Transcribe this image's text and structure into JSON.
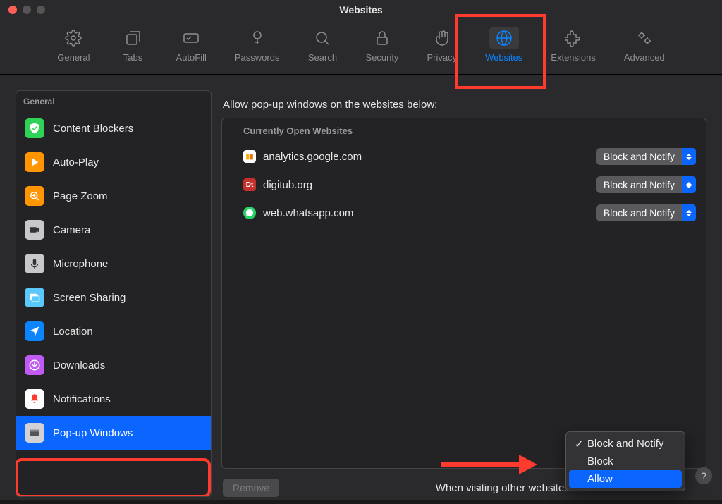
{
  "window": {
    "title": "Websites"
  },
  "toolbar": {
    "items": [
      {
        "label": "General"
      },
      {
        "label": "Tabs"
      },
      {
        "label": "AutoFill"
      },
      {
        "label": "Passwords"
      },
      {
        "label": "Search"
      },
      {
        "label": "Security"
      },
      {
        "label": "Privacy"
      },
      {
        "label": "Websites"
      },
      {
        "label": "Extensions"
      },
      {
        "label": "Advanced"
      }
    ]
  },
  "sidebar": {
    "header": "General",
    "items": [
      {
        "label": "Content Blockers"
      },
      {
        "label": "Auto-Play"
      },
      {
        "label": "Page Zoom"
      },
      {
        "label": "Camera"
      },
      {
        "label": "Microphone"
      },
      {
        "label": "Screen Sharing"
      },
      {
        "label": "Location"
      },
      {
        "label": "Downloads"
      },
      {
        "label": "Notifications"
      },
      {
        "label": "Pop-up Windows"
      }
    ]
  },
  "main": {
    "heading": "Allow pop-up windows on the websites below:",
    "section_header": "Currently Open Websites",
    "sites": [
      {
        "name": "analytics.google.com",
        "setting": "Block and Notify"
      },
      {
        "name": "digitub.org",
        "setting": "Block and Notify"
      },
      {
        "name": "web.whatsapp.com",
        "setting": "Block and Notify"
      }
    ],
    "remove_label": "Remove",
    "other_label": "When visiting other websites:"
  },
  "dropdown": {
    "items": [
      {
        "label": "Block and Notify"
      },
      {
        "label": "Block"
      },
      {
        "label": "Allow"
      }
    ]
  },
  "help": {
    "label": "?"
  },
  "colors": {
    "accent": "#0a66ff",
    "highlight": "#ff3b30"
  }
}
